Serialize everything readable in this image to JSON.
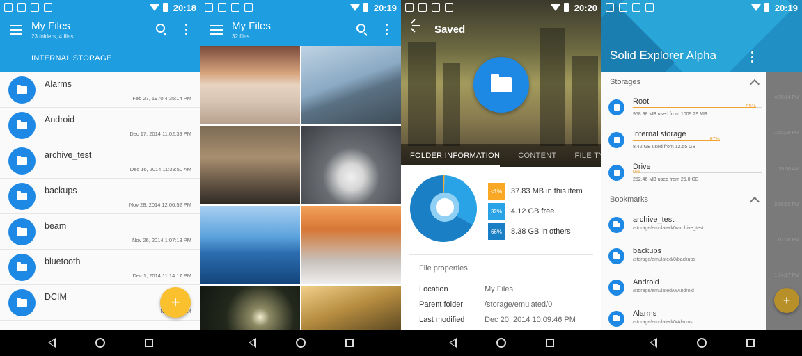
{
  "colors": {
    "primary": "#1e9de0",
    "folder": "#1e88e5",
    "accent": "#fbc02d",
    "usage": "#f2a22e"
  },
  "status_bars": [
    {
      "time": "20:18"
    },
    {
      "time": "20:19"
    },
    {
      "time": "20:20"
    },
    {
      "time": "20:19"
    }
  ],
  "screen1": {
    "title": "My Files",
    "subtitle": "23 folders, 4 files",
    "storage_tab": "INTERNAL STORAGE",
    "fab_label": "+",
    "files": [
      {
        "name": "Alarms",
        "date": "Feb 27, 1970 4:35:14 PM"
      },
      {
        "name": "Android",
        "date": "Dec 17, 2014 11:02:39 PM"
      },
      {
        "name": "archive_test",
        "date": "Dec 16, 2014 11:39:50 AM"
      },
      {
        "name": "backups",
        "date": "Nov 28, 2014 12:06:52 PM"
      },
      {
        "name": "beam",
        "date": "Nov 26, 2014 1:07:18 PM"
      },
      {
        "name": "bluetooth",
        "date": "Dec 1, 2014 11:14:17 PM"
      },
      {
        "name": "DCIM",
        "date": "Nov 25, 2014"
      }
    ]
  },
  "screen2": {
    "title": "My Files",
    "subtitle": "32 files",
    "photos": [
      "desert-dunes",
      "bridge",
      "paris-street",
      "white-sports-car",
      "lake-mountains",
      "snowy-forest-path",
      "glowing-butterflies",
      "sunlit-forest"
    ]
  },
  "screen3": {
    "title": "Saved",
    "tabs": [
      "FOLDER INFORMATION",
      "CONTENT",
      "FILE TYPES"
    ],
    "usage": [
      {
        "badge": "<1%",
        "label": "37.83 MB in this item",
        "color": "#f9a825",
        "fraction": 0.005
      },
      {
        "badge": "32%",
        "label": "4.12 GB free",
        "color": "#29a3e6",
        "fraction": 0.32
      },
      {
        "badge": "66%",
        "label": "8.38 GB in others",
        "color": "#1a7fc4",
        "fraction": 0.66
      }
    ],
    "properties_title": "File properties",
    "properties": [
      {
        "key": "Location",
        "value": "My Files"
      },
      {
        "key": "Parent folder",
        "value": "/storage/emulated/0"
      },
      {
        "key": "Last modified",
        "value": "Dec 20, 2014 10:09:46 PM"
      }
    ]
  },
  "screen4": {
    "app_title": "Solid Explorer Alpha",
    "storages_header": "Storages",
    "bookmarks_header": "Bookmarks",
    "fab_label": "+",
    "storages": [
      {
        "name": "Root",
        "info": "958.98 MB used from 1009.29 MB",
        "pct": "95%",
        "fraction": 0.95,
        "icon": "lock-icon"
      },
      {
        "name": "Internal storage",
        "info": "8.42 GB used from 12.55 GB",
        "pct": "67%",
        "fraction": 0.67,
        "icon": "phone-icon"
      },
      {
        "name": "Drive",
        "info": "252.46 MB used from 25.0 GB",
        "pct": "0%",
        "fraction": 0.0,
        "icon": "google-drive-icon"
      }
    ],
    "bookmarks": [
      {
        "name": "archive_test",
        "path": "/storage/emulated/0/archive_test"
      },
      {
        "name": "backups",
        "path": "/storage/emulated/0/backups"
      },
      {
        "name": "Android",
        "path": "/storage/emulated/0/Android"
      },
      {
        "name": "Alarms",
        "path": "/storage/emulated/0/Alarms"
      }
    ]
  }
}
